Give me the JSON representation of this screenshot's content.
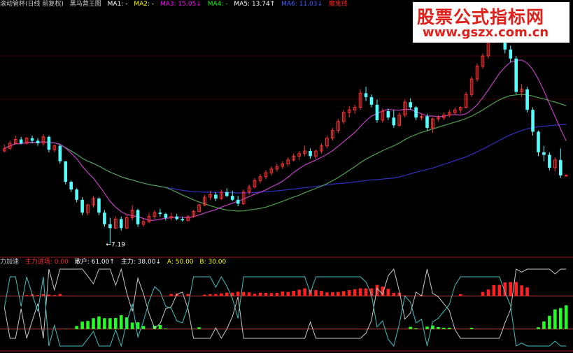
{
  "top_header": {
    "title": "滚动管杯(日线 前复权)",
    "indicator_name": "黑马营王图",
    "items": [
      {
        "label": "MA1: -",
        "color": "#ffffff"
      },
      {
        "label": "MA2: -",
        "color": "#ffff00"
      },
      {
        "label": "MA3: 15.05↓",
        "color": "#ff00ff"
      },
      {
        "label": "MA4: -",
        "color": "#00ff00"
      },
      {
        "label": "MA5: 13.74↑",
        "color": "#ffffff"
      },
      {
        "label": "MA6: 11.03↓",
        "color": "#4060ff"
      },
      {
        "label": "魔鬼线",
        "color": "#ff2020"
      }
    ]
  },
  "bottom_header": {
    "title": "力加速",
    "items": [
      {
        "label": "主力进场: 0.00",
        "color": "#ff3030"
      },
      {
        "label": "散户: 61.00↑",
        "color": "#ffffff"
      },
      {
        "label": "主力: 38.00↓",
        "color": "#ffffff"
      },
      {
        "label": "A: 50.00",
        "color": "#ffff00"
      },
      {
        "label": "B: 30.00",
        "color": "#ffff00"
      }
    ]
  },
  "watermark": {
    "line1": "股票公式指标网",
    "line2": "www.gszx.com.cn"
  },
  "colors": {
    "up": "#ff3232",
    "down": "#54ffff",
    "ma_magenta": "#c040c0",
    "ma_green": "#50a050",
    "ma_blue": "#3030c0",
    "hist_red": "#ff2020",
    "hist_green": "#20ff20"
  },
  "chart_data": [
    {
      "type": "candlestick",
      "annotation": "←7.19",
      "ohlc": [
        [
          14.4,
          14.9,
          14.3,
          14.6
        ],
        [
          14.6,
          15.2,
          14.5,
          15.0
        ],
        [
          15.0,
          15.6,
          14.9,
          15.3
        ],
        [
          15.3,
          15.5,
          14.9,
          15.0
        ],
        [
          15.0,
          15.5,
          14.9,
          15.4
        ],
        [
          15.4,
          15.6,
          15.0,
          15.2
        ],
        [
          15.2,
          15.4,
          14.8,
          15.0
        ],
        [
          15.0,
          15.7,
          14.8,
          15.5
        ],
        [
          15.5,
          15.6,
          14.3,
          14.5
        ],
        [
          14.5,
          14.9,
          14.3,
          14.8
        ],
        [
          14.8,
          14.9,
          13.4,
          13.6
        ],
        [
          13.6,
          13.6,
          11.8,
          12.0
        ],
        [
          12.0,
          12.1,
          11.2,
          11.4
        ],
        [
          11.4,
          11.5,
          10.4,
          10.6
        ],
        [
          10.6,
          10.8,
          9.4,
          9.6
        ],
        [
          9.6,
          10.3,
          9.4,
          10.2
        ],
        [
          10.2,
          10.9,
          10.0,
          10.7
        ],
        [
          10.7,
          10.8,
          9.4,
          9.6
        ],
        [
          9.6,
          9.8,
          8.5,
          8.7
        ],
        [
          8.7,
          9.2,
          7.19,
          8.4
        ],
        [
          8.4,
          9.3,
          8.3,
          9.1
        ],
        [
          9.1,
          9.3,
          8.2,
          8.4
        ],
        [
          8.4,
          9.4,
          8.3,
          9.2
        ],
        [
          9.2,
          10.2,
          9.0,
          9.8
        ],
        [
          9.8,
          9.9,
          8.5,
          8.7
        ],
        [
          8.7,
          9.1,
          8.5,
          8.9
        ],
        [
          8.9,
          9.6,
          8.8,
          9.3
        ],
        [
          9.3,
          9.8,
          9.1,
          9.6
        ],
        [
          9.6,
          9.9,
          9.3,
          9.5
        ],
        [
          9.5,
          9.6,
          9.0,
          9.2
        ],
        [
          9.2,
          9.6,
          9.0,
          9.3
        ],
        [
          9.3,
          9.5,
          9.0,
          9.1
        ],
        [
          9.1,
          9.3,
          8.9,
          9.0
        ],
        [
          9.0,
          9.4,
          8.9,
          9.3
        ],
        [
          9.3,
          9.8,
          9.2,
          9.7
        ],
        [
          9.7,
          10.3,
          9.6,
          10.2
        ],
        [
          10.2,
          11.0,
          10.1,
          10.8
        ],
        [
          10.8,
          11.3,
          10.6,
          11.0
        ],
        [
          11.0,
          11.2,
          10.5,
          10.7
        ],
        [
          10.7,
          11.4,
          10.6,
          11.2
        ],
        [
          11.2,
          11.5,
          10.8,
          10.9
        ],
        [
          10.9,
          11.3,
          10.5,
          10.6
        ],
        [
          10.6,
          10.9,
          10.1,
          10.3
        ],
        [
          10.3,
          11.4,
          10.2,
          11.2
        ],
        [
          11.2,
          11.8,
          11.0,
          11.6
        ],
        [
          11.6,
          12.3,
          11.5,
          12.1
        ],
        [
          12.1,
          12.6,
          11.9,
          12.4
        ],
        [
          12.4,
          12.9,
          12.2,
          12.7
        ],
        [
          12.7,
          13.2,
          12.5,
          13.0
        ],
        [
          13.0,
          13.4,
          12.8,
          13.2
        ],
        [
          13.2,
          13.6,
          13.0,
          13.4
        ],
        [
          13.4,
          13.9,
          13.2,
          13.7
        ],
        [
          13.7,
          14.2,
          13.6,
          14.0
        ],
        [
          14.0,
          14.4,
          13.7,
          14.2
        ],
        [
          14.2,
          14.8,
          14.0,
          14.4
        ],
        [
          14.4,
          14.6,
          13.8,
          14.0
        ],
        [
          14.0,
          14.5,
          13.8,
          14.4
        ],
        [
          14.4,
          15.0,
          14.2,
          14.8
        ],
        [
          14.8,
          15.6,
          14.6,
          15.4
        ],
        [
          15.4,
          16.2,
          15.2,
          16.0
        ],
        [
          16.0,
          16.9,
          15.8,
          16.7
        ],
        [
          16.7,
          17.6,
          16.5,
          17.4
        ],
        [
          17.4,
          17.9,
          17.0,
          17.6
        ],
        [
          17.6,
          18.0,
          17.3,
          17.8
        ],
        [
          17.8,
          19.2,
          17.6,
          18.9
        ],
        [
          18.9,
          19.4,
          18.3,
          18.6
        ],
        [
          18.6,
          18.8,
          17.8,
          18.0
        ],
        [
          18.0,
          18.4,
          16.6,
          16.8
        ],
        [
          16.8,
          17.7,
          16.6,
          17.5
        ],
        [
          17.5,
          17.7,
          16.8,
          17.0
        ],
        [
          17.0,
          17.6,
          16.2,
          16.4
        ],
        [
          16.4,
          17.4,
          16.3,
          17.2
        ],
        [
          17.2,
          18.4,
          17.0,
          18.2
        ],
        [
          18.2,
          18.5,
          17.6,
          17.8
        ],
        [
          17.8,
          17.9,
          16.8,
          17.0
        ],
        [
          17.0,
          17.3,
          16.8,
          17.1
        ],
        [
          17.1,
          17.3,
          16.0,
          16.2
        ],
        [
          16.2,
          17.0,
          15.8,
          16.9
        ],
        [
          16.9,
          17.2,
          16.7,
          17.0
        ],
        [
          17.0,
          17.4,
          16.8,
          17.2
        ],
        [
          17.2,
          17.6,
          17.0,
          17.4
        ],
        [
          17.4,
          17.8,
          17.2,
          17.6
        ],
        [
          17.6,
          17.9,
          17.3,
          17.8
        ],
        [
          17.8,
          19.0,
          17.7,
          18.8
        ],
        [
          18.8,
          20.2,
          18.6,
          20.0
        ],
        [
          20.0,
          21.2,
          19.8,
          21.0
        ],
        [
          21.0,
          22.0,
          20.8,
          21.8
        ],
        [
          21.8,
          23.2,
          21.6,
          23.0
        ],
        [
          23.0,
          23.6,
          22.8,
          23.4
        ],
        [
          23.4,
          24.0,
          23.1,
          23.6
        ],
        [
          23.6,
          23.8,
          22.0,
          22.3
        ],
        [
          22.3,
          22.6,
          21.3,
          21.6
        ],
        [
          21.6,
          21.8,
          18.8,
          19.0
        ],
        [
          19.0,
          19.6,
          18.6,
          19.2
        ],
        [
          19.2,
          19.4,
          17.4,
          17.6
        ],
        [
          17.6,
          17.8,
          15.6,
          15.9
        ],
        [
          15.9,
          16.0,
          14.0,
          14.3
        ],
        [
          14.3,
          14.8,
          13.6,
          14.1
        ],
        [
          14.1,
          14.3,
          12.9,
          13.1
        ],
        [
          13.1,
          13.9,
          12.8,
          13.7
        ],
        [
          13.7,
          14.6,
          12.3,
          12.5
        ],
        [
          12.5,
          12.6,
          12.4,
          12.5
        ]
      ]
    },
    {
      "type": "histogram",
      "a": 50,
      "b": 30
    }
  ]
}
